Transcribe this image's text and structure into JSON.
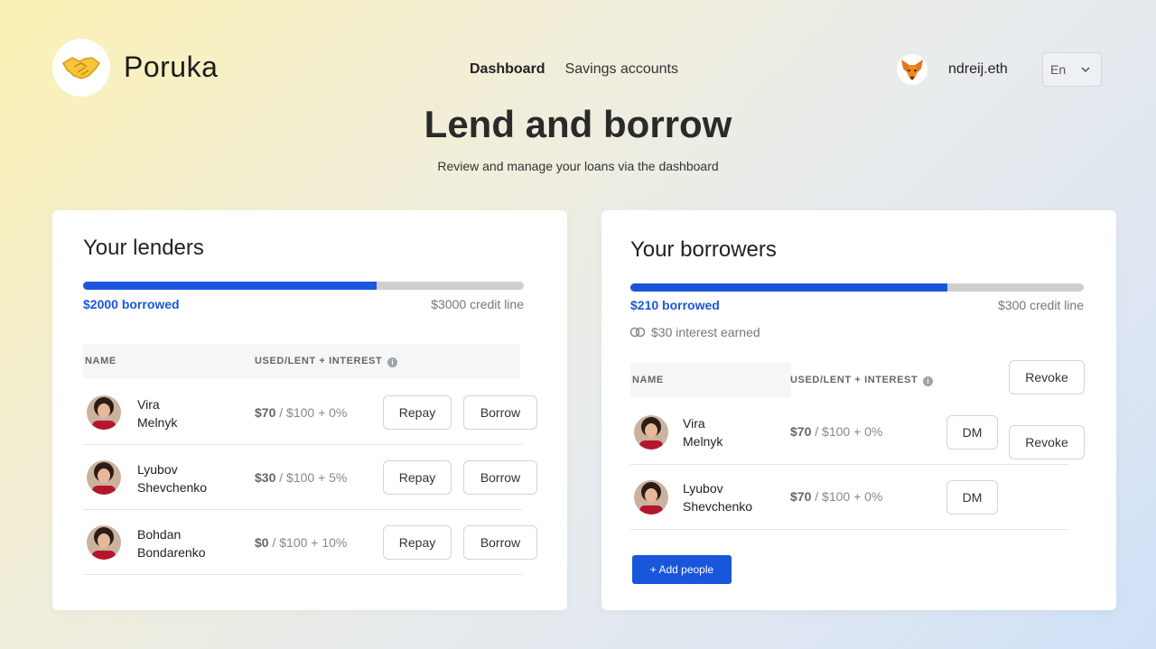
{
  "header": {
    "brand": "Poruka",
    "logo_icon": "handshake-icon",
    "nav": [
      {
        "label": "Dashboard",
        "active": true
      },
      {
        "label": "Savings accounts",
        "active": false
      }
    ],
    "wallet_icon": "metamask-fox-icon",
    "username": "ndreij.eth",
    "language": "En"
  },
  "hero": {
    "title": "Lend and borrow",
    "subtitle": "Review and manage your loans via the dashboard"
  },
  "lenders": {
    "title": "Your lenders",
    "progress": 0.667,
    "borrowed": "$2000 borrowed",
    "credit_line": "$3000 credit line",
    "columns": [
      "NAME",
      "USED/LENT + INTEREST"
    ],
    "rows": [
      {
        "first": "Vira",
        "last": "Melnyk",
        "used": "$70",
        "rest": " / $100 + 0%",
        "btn1": "Repay",
        "btn2": "Borrow"
      },
      {
        "first": "Lyubov",
        "last": "Shevchenko",
        "used": "$30",
        "rest": " / $100 + 5%",
        "btn1": "Repay",
        "btn2": "Borrow"
      },
      {
        "first": "Bohdan",
        "last": "Bondarenko",
        "used": "$0",
        "rest": " / $100 + 10%",
        "btn1": "Repay",
        "btn2": "Borrow"
      }
    ]
  },
  "borrowers": {
    "title": "Your borrowers",
    "progress": 0.7,
    "borrowed": "$210 borrowed",
    "credit_line": "$300 credit line",
    "interest_earned": "$30 interest earned",
    "columns": [
      "NAME",
      "USED/LENT + INTEREST"
    ],
    "header_action": "Revoke",
    "rows": [
      {
        "first": "Vira",
        "last": "Melnyk",
        "used": "$70",
        "rest": " / $100 + 0%",
        "btn1": "DM",
        "btn2": "Revoke"
      },
      {
        "first": "Lyubov",
        "last": "Shevchenko",
        "used": "$70",
        "rest": " / $100 + 0%",
        "btn1": "DM"
      }
    ],
    "add_button": "+ Add people"
  },
  "colors": {
    "accent": "#1a56db",
    "progress_track": "#cfcfcf"
  }
}
